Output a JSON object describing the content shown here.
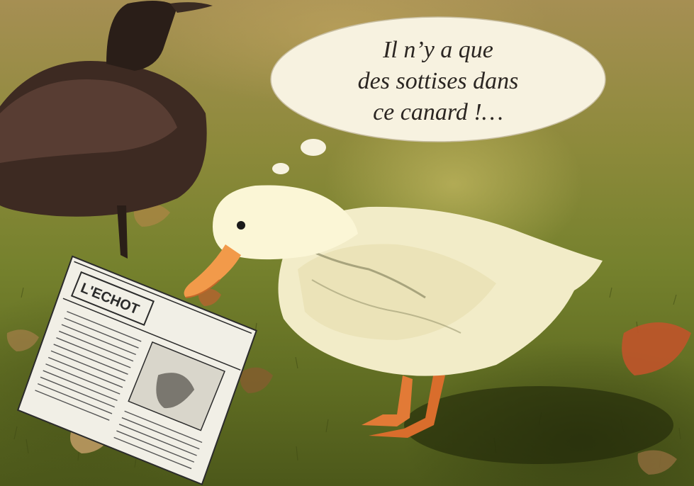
{
  "bubble": {
    "lines": [
      "Il n’y a que",
      "des sottises dans",
      "ce canard !…"
    ]
  },
  "newspaper": {
    "masthead": "L'ECHOT"
  }
}
